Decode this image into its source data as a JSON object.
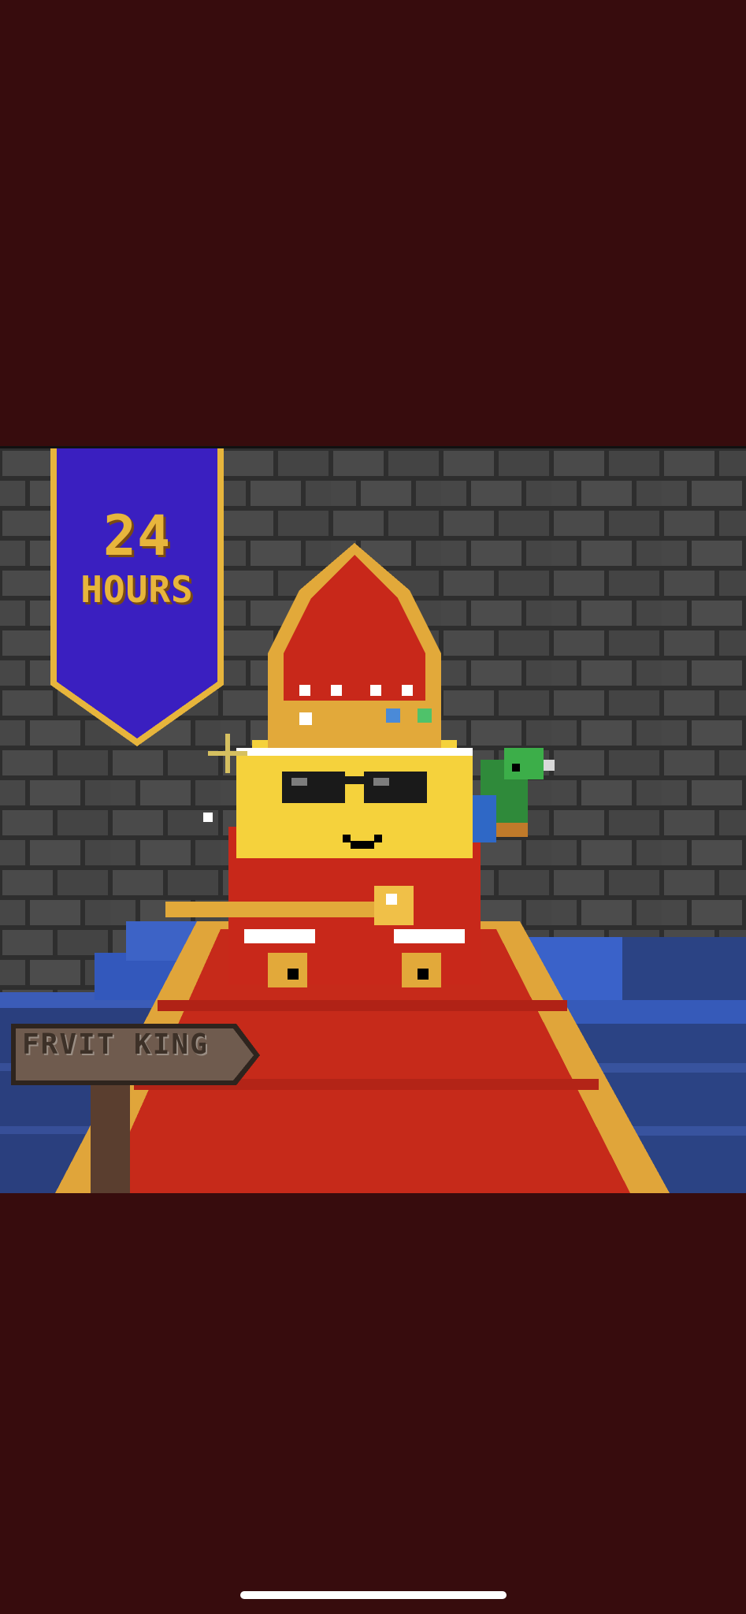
{
  "banner": {
    "number": "24",
    "word": "HOURS"
  },
  "signpost": {
    "label": "FRVIT KING"
  },
  "colors": {
    "letterbox": "#370c0d",
    "wall": "#3a3a3a",
    "banner": "#3a1fc0",
    "gold": "#e7b53c",
    "carpet": "#c62a1a",
    "steps": "#2f56b4"
  }
}
